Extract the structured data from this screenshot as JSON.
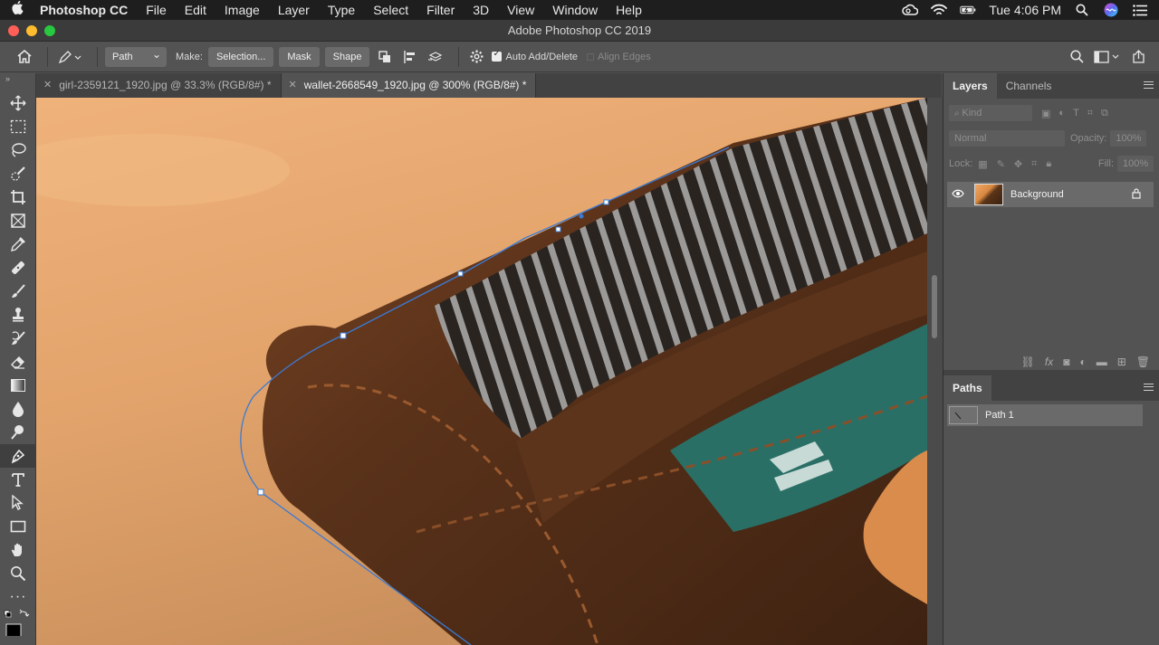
{
  "menubar": {
    "app_name": "Photoshop CC",
    "items": [
      "File",
      "Edit",
      "Image",
      "Layer",
      "Type",
      "Select",
      "Filter",
      "3D",
      "View",
      "Window",
      "Help"
    ],
    "clock": "Tue 4:06 PM"
  },
  "window": {
    "title": "Adobe Photoshop CC 2019"
  },
  "options": {
    "mode": "Path",
    "make_label": "Make:",
    "selection_button": "Selection...",
    "mask_button": "Mask",
    "shape_button": "Shape",
    "auto_add_delete": "Auto Add/Delete",
    "align_edges": "Align Edges"
  },
  "tabs": [
    {
      "label": "girl-2359121_1920.jpg @ 33.3% (RGB/8#) *",
      "active": false
    },
    {
      "label": "wallet-2668549_1920.jpg @ 300% (RGB/8#) *",
      "active": true
    }
  ],
  "layers_panel": {
    "tabs": [
      "Layers",
      "Channels"
    ],
    "kind_label": "Kind",
    "blend_mode": "Normal",
    "opacity_label": "Opacity:",
    "opacity_value": "100%",
    "lock_label": "Lock:",
    "fill_label": "Fill:",
    "fill_value": "100%",
    "layers": [
      {
        "name": "Background"
      }
    ]
  },
  "paths_panel": {
    "title": "Paths",
    "paths": [
      {
        "name": "Path 1"
      }
    ]
  },
  "colors": {
    "menubar_bg": "#1e1e1e",
    "panel_bg": "#535353",
    "path_line": "#3a7bd5"
  }
}
